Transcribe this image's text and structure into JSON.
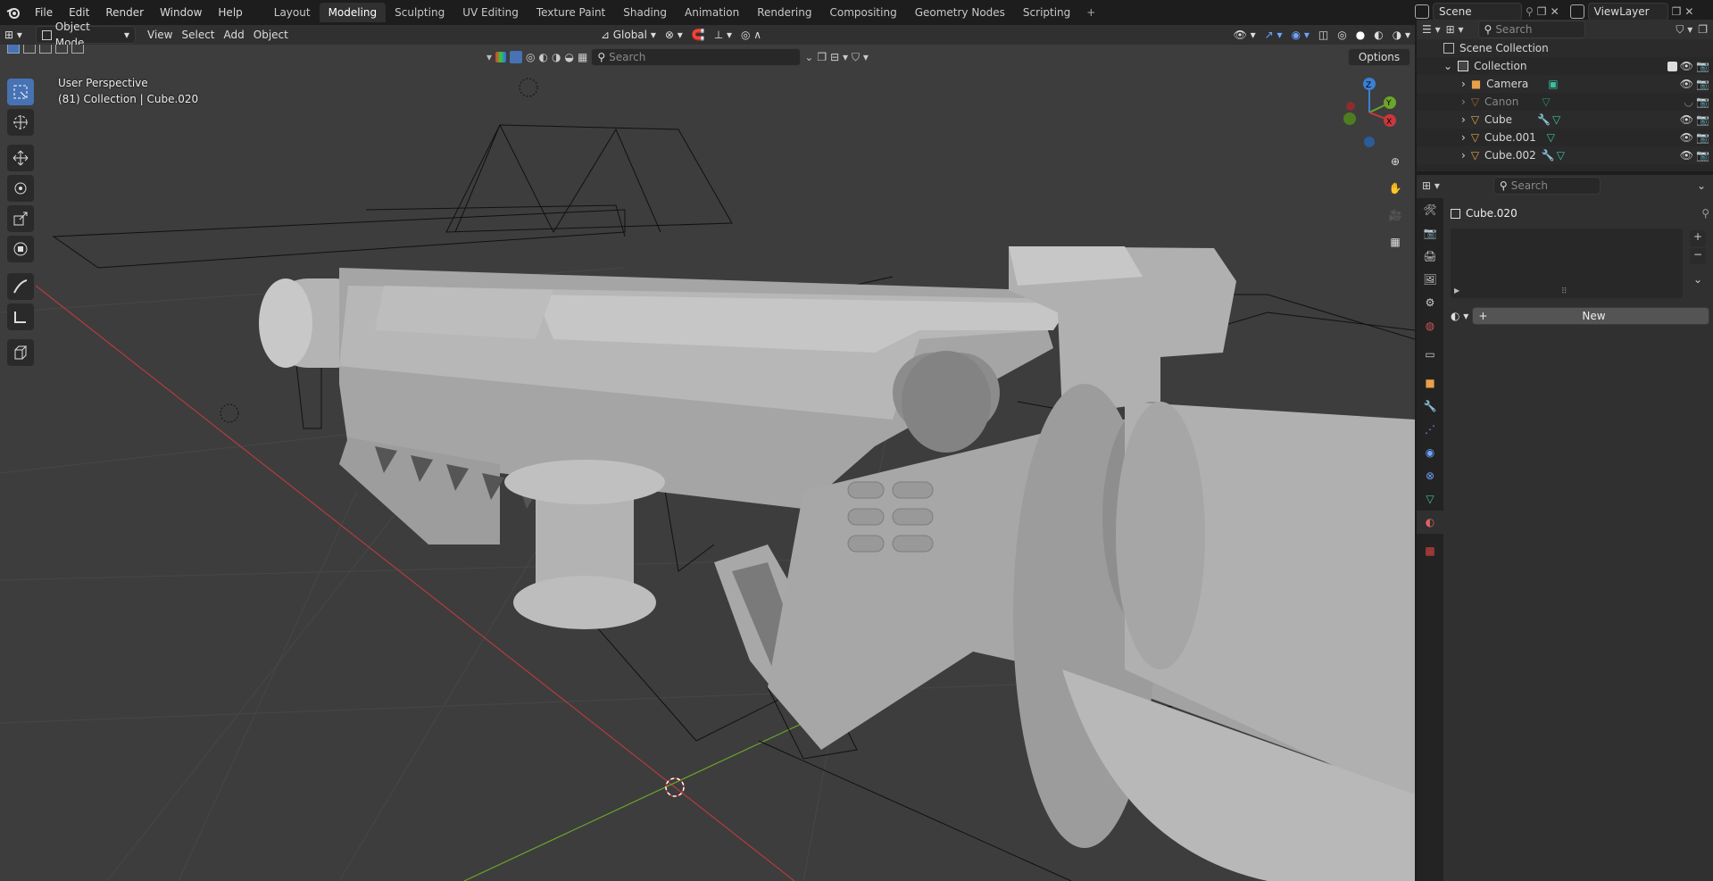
{
  "menubar": {
    "items": [
      "File",
      "Edit",
      "Render",
      "Window",
      "Help"
    ]
  },
  "workspaces": {
    "tabs": [
      "Layout",
      "Modeling",
      "Sculpting",
      "UV Editing",
      "Texture Paint",
      "Shading",
      "Animation",
      "Rendering",
      "Compositing",
      "Geometry Nodes",
      "Scripting"
    ],
    "active": "Modeling"
  },
  "scene": {
    "name": "Scene",
    "view_layer": "ViewLayer"
  },
  "viewport_header": {
    "mode": "Object Mode",
    "menus": [
      "View",
      "Select",
      "Add",
      "Object"
    ],
    "transform_orientation": "Global",
    "search_placeholder": "Search",
    "options_label": "Options"
  },
  "viewport": {
    "perspective_label": "User Perspective",
    "collection_label": "(81) Collection | Cube.020",
    "gizmo": {
      "x": "X",
      "y": "Y",
      "z": "Z"
    }
  },
  "outliner": {
    "search_placeholder": "Search",
    "root": "Scene Collection",
    "collection": "Collection",
    "items": [
      {
        "name": "Camera",
        "type": "camera"
      },
      {
        "name": "Canon",
        "type": "mesh",
        "hidden": true
      },
      {
        "name": "Cube",
        "type": "mesh"
      },
      {
        "name": "Cube.001",
        "type": "mesh"
      },
      {
        "name": "Cube.002",
        "type": "mesh"
      }
    ]
  },
  "properties": {
    "search_placeholder": "Search",
    "object_name": "Cube.020",
    "new_label": "New"
  },
  "colors": {
    "accent": "#4772b3",
    "x_axis": "#c8383d",
    "y_axis": "#6ba52a",
    "z_axis": "#3a7fd6",
    "mesh_orange": "#e8a04a",
    "mesh_teal": "#3cc0a2"
  }
}
